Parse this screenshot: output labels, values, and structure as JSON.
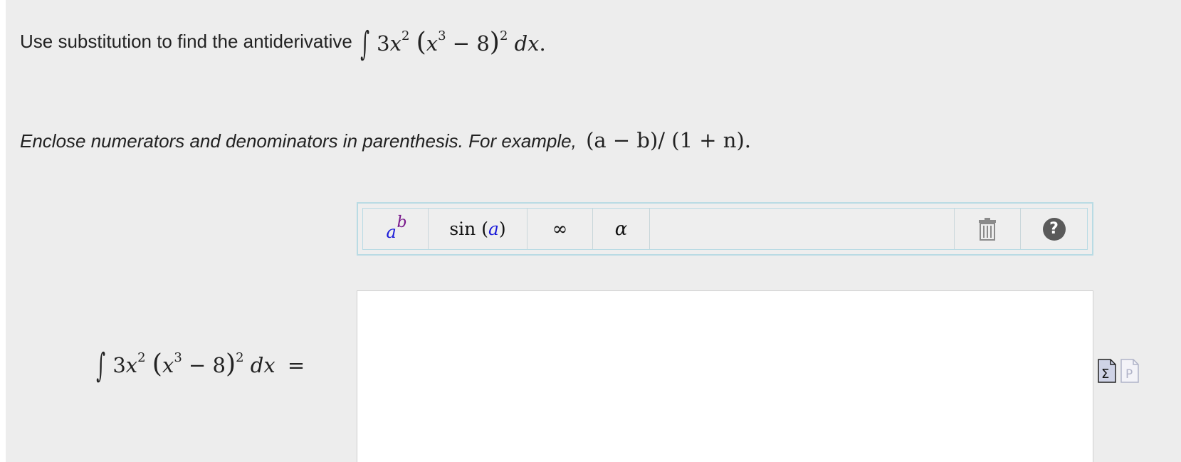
{
  "question": {
    "prompt": "Use substitution to find the antiderivative",
    "integral": {
      "integral_sign": "∫",
      "coefficient": "3",
      "var": "x",
      "power": "2",
      "inner_var": "x",
      "inner_power": "3",
      "minus": "−",
      "constant": "8",
      "outer_power": "2",
      "differential": "dx",
      "period": "."
    }
  },
  "hint": {
    "text": "Enclose numerators and denominators in parenthesis. For example,",
    "example": "(a − b)/ (1 + n)."
  },
  "toolbar": {
    "power": {
      "base": "a",
      "exponent": "b"
    },
    "function": {
      "name": "sin",
      "arg": "a"
    },
    "infinity": "∞",
    "greek": "α"
  },
  "answer": {
    "equals": "=",
    "value": ""
  },
  "colors": {
    "background": "#ededed",
    "toolbar_border": "#b9dbe4",
    "power_base": "#1a1ad8",
    "power_exponent": "#7a1a8c"
  }
}
